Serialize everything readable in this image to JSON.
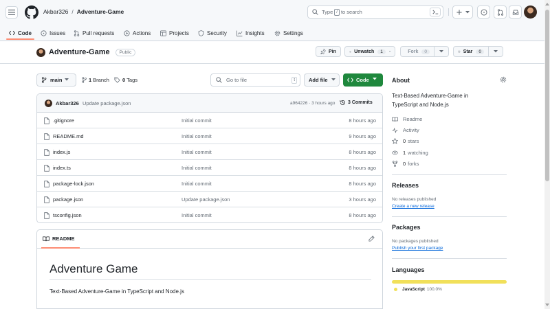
{
  "header": {
    "owner": "Akbar326",
    "separator": "/",
    "repo": "Adventure-Game",
    "search_before": "Type",
    "search_key": "/",
    "search_after": "to search"
  },
  "tabs": [
    {
      "label": "Code",
      "icon": "code-icon"
    },
    {
      "label": "Issues",
      "icon": "issue-icon"
    },
    {
      "label": "Pull requests",
      "icon": "pull-request-icon"
    },
    {
      "label": "Actions",
      "icon": "play-icon"
    },
    {
      "label": "Projects",
      "icon": "table-icon"
    },
    {
      "label": "Security",
      "icon": "shield-icon"
    },
    {
      "label": "Insights",
      "icon": "graph-icon"
    },
    {
      "label": "Settings",
      "icon": "gear-icon"
    }
  ],
  "repo": {
    "name": "Adventure-Game",
    "visibility": "Public",
    "pin_label": "Pin",
    "unwatch_label": "Unwatch",
    "watch_count": "1",
    "fork_label": "Fork",
    "fork_count": "0",
    "star_label": "Star",
    "star_count": "0"
  },
  "controls": {
    "branch": "main",
    "branch_count": "1",
    "branch_label": "Branch",
    "tag_count": "0",
    "tag_label": "Tags",
    "goto_placeholder": "Go to file",
    "goto_key": "t",
    "add_file": "Add file",
    "code_button": "Code"
  },
  "commit": {
    "author": "Akbar326",
    "message": "Update package.json",
    "meta": "a964226 · 3 hours ago",
    "count_label": "3 Commits"
  },
  "files": [
    {
      "name": ".gitignore",
      "message": "Initial commit",
      "time": "8 hours ago"
    },
    {
      "name": "README.md",
      "message": "Initial commit",
      "time": "9 hours ago"
    },
    {
      "name": "index.js",
      "message": "Initial commit",
      "time": "8 hours ago"
    },
    {
      "name": "index.ts",
      "message": "Initial commit",
      "time": "8 hours ago"
    },
    {
      "name": "package-lock.json",
      "message": "Initial commit",
      "time": "8 hours ago"
    },
    {
      "name": "package.json",
      "message": "Update package.json",
      "time": "3 hours ago"
    },
    {
      "name": "tsconfig.json",
      "message": "Initial commit",
      "time": "8 hours ago"
    }
  ],
  "readme": {
    "tab_label": "README",
    "heading": "Adventure Game",
    "paragraph": "Text-Based Adventure-Game in TypeScript and Node.js"
  },
  "about": {
    "title": "About",
    "description": "Text-Based Adventure-Game in TypeScript and Node.js",
    "readme": "Readme",
    "activity": "Activity",
    "stars_count": "0",
    "stars_label": "stars",
    "watching_count": "1",
    "watching_label": "watching",
    "forks_count": "0",
    "forks_label": "forks"
  },
  "releases": {
    "title": "Releases",
    "empty": "No releases published",
    "link": "Create a new release"
  },
  "packages": {
    "title": "Packages",
    "empty": "No packages published",
    "link": "Publish your first package"
  },
  "languages": {
    "title": "Languages",
    "items": [
      {
        "name": "JavaScript",
        "percent": "100.0%",
        "color": "#f1e05a"
      }
    ]
  },
  "colors": {
    "accent_tab": "#fd8c73",
    "code_button": "#1f883d",
    "link": "#0969da"
  }
}
